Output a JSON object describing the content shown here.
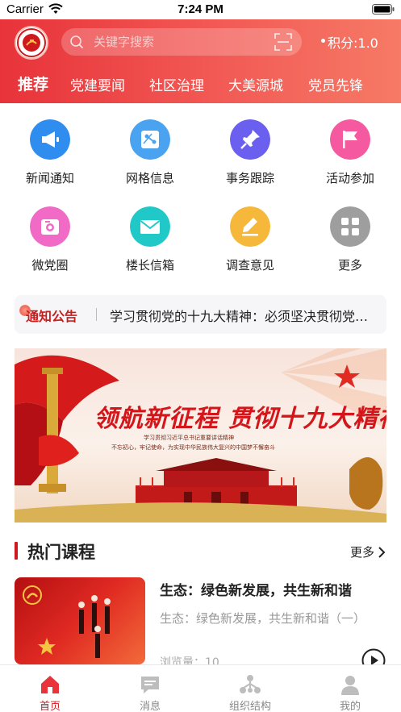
{
  "status_bar": {
    "carrier": "Carrier",
    "time": "7:24 PM"
  },
  "header": {
    "search_placeholder": "关键字搜索",
    "points_label": "积分:",
    "points_value": "1.0"
  },
  "tabs": [
    {
      "label": "推荐"
    },
    {
      "label": "党建要闻"
    },
    {
      "label": "社区治理"
    },
    {
      "label": "大美源城"
    },
    {
      "label": "党员先锋"
    }
  ],
  "grid": [
    {
      "label": "新闻通知",
      "icon": "megaphone-icon",
      "color": "#2f8df0"
    },
    {
      "label": "网格信息",
      "icon": "grid-info-icon",
      "color": "#4aa3f0"
    },
    {
      "label": "事务跟踪",
      "icon": "pin-icon",
      "color": "#6b5ff0"
    },
    {
      "label": "活动参加",
      "icon": "flag-icon",
      "color": "#f55aa0"
    },
    {
      "label": "微党圈",
      "icon": "camera-icon",
      "color": "#f06ac6"
    },
    {
      "label": "楼长信箱",
      "icon": "mail-icon",
      "color": "#20c8c8"
    },
    {
      "label": "调查意见",
      "icon": "edit-icon",
      "color": "#f5b83a"
    },
    {
      "label": "更多",
      "icon": "more-icon",
      "color": "#9e9e9e"
    }
  ],
  "notice": {
    "title": "通知公告",
    "text": "学习贯彻党的十九大精神：必须坚决贯彻党中央决策部署"
  },
  "banner": {
    "title": "领航新征程 贯彻十九大精神",
    "sub1": "学习贯彻习近平总书记重要讲话精神",
    "sub2": "不忘初心，牢记使命，为实现中华民族伟大复兴的中国梦不懈奋斗"
  },
  "section": {
    "title": "热门课程",
    "more": "更多"
  },
  "course": {
    "title": "生态：绿色新发展，共生新和谐",
    "desc": "生态：绿色新发展，共生新和谐（一）",
    "views": "浏览量：10"
  },
  "bottom_nav": [
    {
      "label": "首页",
      "icon": "home-icon",
      "active": true
    },
    {
      "label": "消息",
      "icon": "message-icon",
      "active": false
    },
    {
      "label": "组织结构",
      "icon": "org-structure-icon",
      "active": false
    },
    {
      "label": "我的",
      "icon": "profile-icon",
      "active": false
    }
  ],
  "colors": {
    "brand_red": "#e8333a",
    "accent_red": "#d0191c"
  }
}
